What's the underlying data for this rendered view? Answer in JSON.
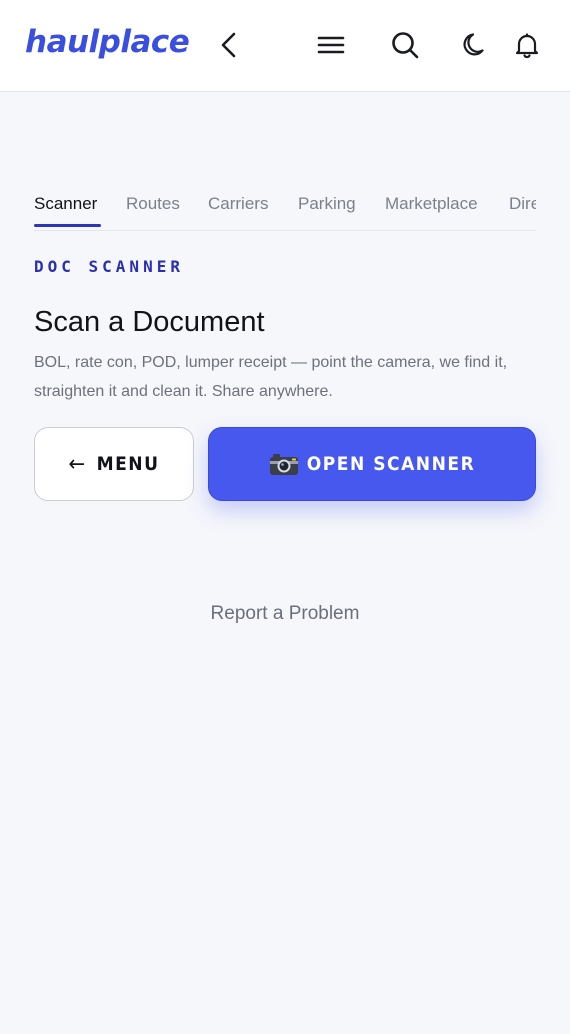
{
  "header": {
    "logo": "haulplace",
    "icons": [
      "back-chevron-icon",
      "menu-icon",
      "search-icon",
      "dark-mode-icon",
      "notification-bell-icon"
    ]
  },
  "tabs": [
    {
      "label": "Scanner",
      "active": true
    },
    {
      "label": "Routes",
      "active": false
    },
    {
      "label": "Carriers",
      "active": false
    },
    {
      "label": "Parking",
      "active": false
    },
    {
      "label": "Marketplace",
      "active": false
    },
    {
      "label": "Dire",
      "active": false
    }
  ],
  "section": {
    "eyebrow": "DOC SCANNER",
    "title": "Scan a Document",
    "description": "BOL, rate con, POD, lumper receipt — point the camera, we find it, straighten it and clean it. Share anywhere."
  },
  "buttons": {
    "menu_label": "MENU",
    "menu_arrow": "←",
    "scanner_label": "OPEN SCANNER",
    "scanner_icon": "camera-icon"
  },
  "footer": {
    "report_link": "Report a Problem"
  },
  "colors": {
    "brand": "#3a4fe0",
    "accent": "#4758ee",
    "eyebrow": "#2a2fb0",
    "background": "#f6f7fb"
  }
}
